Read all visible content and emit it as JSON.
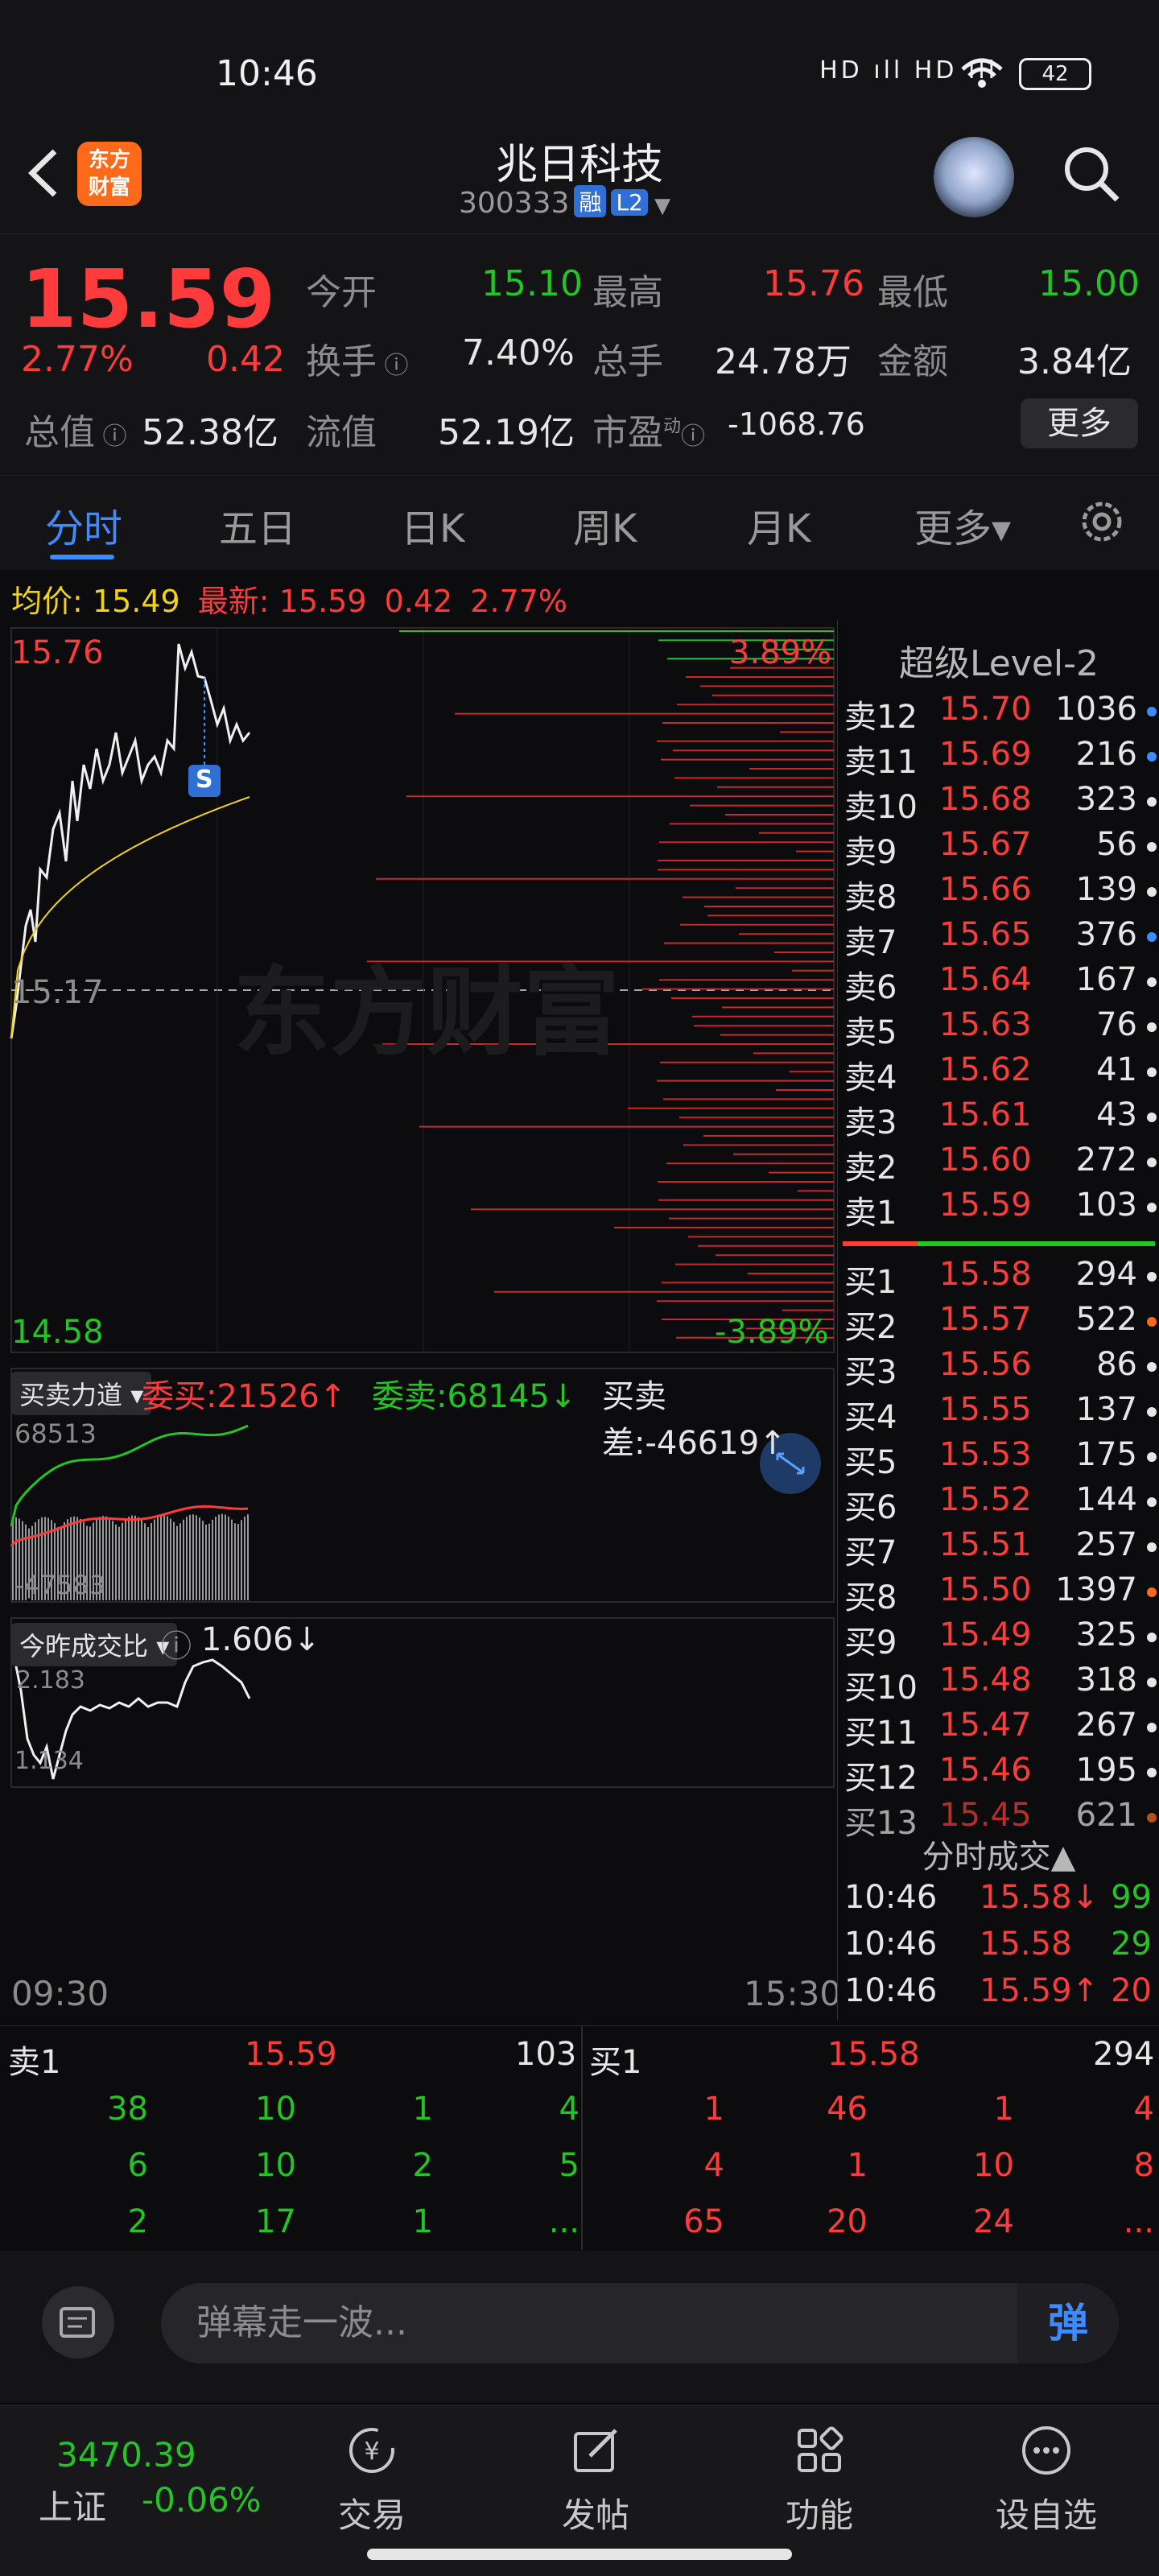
{
  "status_bar": {
    "time": "10:46",
    "signal": "HD ıll HD ıll",
    "battery": "42"
  },
  "header": {
    "logo_text_1": "东方",
    "logo_text_2": "财富",
    "stock_name": "兆日科技",
    "stock_code": "300333",
    "tag_margin": "融",
    "tag_level": "L2"
  },
  "quote": {
    "price": "15.59",
    "change_pct": "2.77%",
    "change": "0.42",
    "open_label": "今开",
    "open": "15.10",
    "high_label": "最高",
    "high": "15.76",
    "low_label": "最低",
    "low": "15.00",
    "turnover_label": "换手",
    "turnover": "7.40%",
    "volume_label": "总手",
    "volume": "24.78万",
    "amount_label": "金额",
    "amount": "3.84亿",
    "mktcap_label": "总值",
    "mktcap": "52.38亿",
    "float_label": "流值",
    "float": "52.19亿",
    "pe_label": "市盈",
    "pe_sup": "动",
    "pe": "-1068.76",
    "more": "更多"
  },
  "tabs": [
    {
      "label": "分时",
      "active": true
    },
    {
      "label": "五日"
    },
    {
      "label": "日K"
    },
    {
      "label": "周K"
    },
    {
      "label": "月K"
    },
    {
      "label": "更多▾"
    }
  ],
  "infoline": {
    "avg_label": "均价:",
    "avg": "15.49",
    "last_label": "最新:",
    "last": "15.59",
    "chg": "0.42",
    "pct": "2.77%"
  },
  "chart": {
    "price_top": "15.76",
    "pct_top": "3.89%",
    "price_mid": "15.17",
    "price_bottom": "14.58",
    "pct_bottom": "-3.89%",
    "watermark": "东方财富",
    "marker": "S",
    "force_label": "买卖力道",
    "bid_label": "委买:21526↑",
    "ask_label": "委卖:68145↓",
    "diff_label": "买卖差:-46619↑",
    "force_top": "68513",
    "force_bottom": "-47583",
    "ratio_label": "今昨成交比",
    "ratio_value": "1.606↓",
    "ratio_top": "2.183",
    "ratio_bottom": "1.134",
    "time_start": "09:30",
    "time_end": "15:30"
  },
  "level2": {
    "title": "超级Level-2",
    "asks": [
      {
        "label": "卖12",
        "price": "15.70",
        "vol": "1036",
        "dot": "#3d8bff"
      },
      {
        "label": "卖11",
        "price": "15.69",
        "vol": "216",
        "dot": "#3d8bff"
      },
      {
        "label": "卖10",
        "price": "15.68",
        "vol": "323",
        "dot": "#e6e6e6"
      },
      {
        "label": "卖9",
        "price": "15.67",
        "vol": "56",
        "dot": "#e6e6e6"
      },
      {
        "label": "卖8",
        "price": "15.66",
        "vol": "139",
        "dot": "#e6e6e6"
      },
      {
        "label": "卖7",
        "price": "15.65",
        "vol": "376",
        "dot": "#3d8bff"
      },
      {
        "label": "卖6",
        "price": "15.64",
        "vol": "167",
        "dot": "#e6e6e6"
      },
      {
        "label": "卖5",
        "price": "15.63",
        "vol": "76",
        "dot": "#e6e6e6"
      },
      {
        "label": "卖4",
        "price": "15.62",
        "vol": "41",
        "dot": "#e6e6e6"
      },
      {
        "label": "卖3",
        "price": "15.61",
        "vol": "43",
        "dot": "#e6e6e6"
      },
      {
        "label": "卖2",
        "price": "15.60",
        "vol": "272",
        "dot": "#e6e6e6"
      },
      {
        "label": "卖1",
        "price": "15.59",
        "vol": "103",
        "dot": "#e6e6e6"
      }
    ],
    "bids": [
      {
        "label": "买1",
        "price": "15.58",
        "vol": "294",
        "dot": "#e6e6e6"
      },
      {
        "label": "买2",
        "price": "15.57",
        "vol": "522",
        "dot": "#ff6a1a"
      },
      {
        "label": "买3",
        "price": "15.56",
        "vol": "86",
        "dot": "#e6e6e6"
      },
      {
        "label": "买4",
        "price": "15.55",
        "vol": "137",
        "dot": "#e6e6e6"
      },
      {
        "label": "买5",
        "price": "15.53",
        "vol": "175",
        "dot": "#e6e6e6"
      },
      {
        "label": "买6",
        "price": "15.52",
        "vol": "144",
        "dot": "#e6e6e6"
      },
      {
        "label": "买7",
        "price": "15.51",
        "vol": "257",
        "dot": "#e6e6e6"
      },
      {
        "label": "买8",
        "price": "15.50",
        "vol": "1397",
        "dot": "#ff6a1a"
      },
      {
        "label": "买9",
        "price": "15.49",
        "vol": "325",
        "dot": "#e6e6e6"
      },
      {
        "label": "买10",
        "price": "15.48",
        "vol": "318",
        "dot": "#e6e6e6"
      },
      {
        "label": "买11",
        "price": "15.47",
        "vol": "267",
        "dot": "#e6e6e6"
      },
      {
        "label": "买12",
        "price": "15.46",
        "vol": "195",
        "dot": "#e6e6e6"
      },
      {
        "label": "买13",
        "price": "15.45",
        "vol": "621",
        "dot": "#ff6a1a"
      }
    ],
    "trades_title": "分时成交▲",
    "trades": [
      {
        "time": "10:46",
        "price": "15.58↓",
        "vol": "99",
        "pcolor": "#ff3b3b",
        "vcolor": "#23c423"
      },
      {
        "time": "10:46",
        "price": "15.58",
        "vol": "29",
        "pcolor": "#ff3b3b",
        "vcolor": "#23c423"
      },
      {
        "time": "10:46",
        "price": "15.59↑",
        "vol": "20",
        "pcolor": "#ff3b3b",
        "vcolor": "#ff3b3b"
      }
    ]
  },
  "depth": {
    "ask_label": "卖1",
    "ask_price": "15.59",
    "ask_vol": "103",
    "bid_label": "买1",
    "bid_price": "15.58",
    "bid_vol": "294",
    "ask_queue": [
      [
        "38",
        "10",
        "1",
        "4"
      ],
      [
        "6",
        "10",
        "2",
        "5"
      ],
      [
        "2",
        "17",
        "1",
        "..."
      ]
    ],
    "bid_queue": [
      [
        "1",
        "46",
        "1",
        "4"
      ],
      [
        "4",
        "1",
        "10",
        "8"
      ],
      [
        "65",
        "20",
        "24",
        "..."
      ]
    ]
  },
  "danmu": {
    "placeholder": "弹幕走一波...",
    "button": "弹"
  },
  "nav": {
    "index_value": "3470.39",
    "index_name": "上证",
    "index_change": "-0.06%",
    "items": [
      {
        "label": "交易",
        "icon": "yuan-refresh-icon"
      },
      {
        "label": "发帖",
        "icon": "edit-icon"
      },
      {
        "label": "功能",
        "icon": "grid-icon"
      },
      {
        "label": "设自选",
        "icon": "more-dots-icon"
      }
    ]
  },
  "colors": {
    "up": "#ff3b3b",
    "down": "#23c423",
    "accent": "#3d8bff",
    "avg_line": "#f1d21a"
  }
}
